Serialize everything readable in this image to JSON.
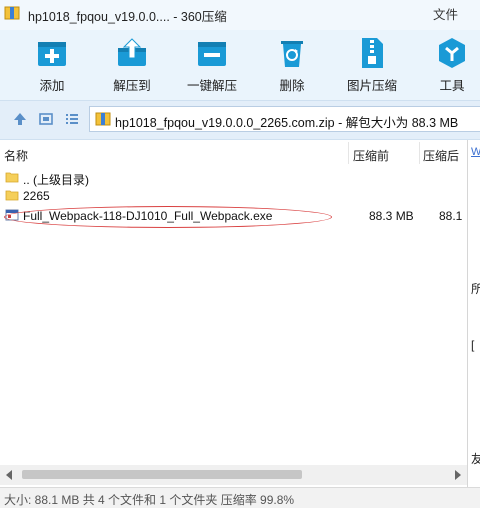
{
  "window": {
    "title": "hp1018_fpqou_v19.0.0.... - 360压缩",
    "menu_file": "文件"
  },
  "toolbar": {
    "items": [
      {
        "label": "添加",
        "icon": "add-icon"
      },
      {
        "label": "解压到",
        "icon": "extract-to-icon"
      },
      {
        "label": "一键解压",
        "icon": "one-click-extract-icon"
      },
      {
        "label": "删除",
        "icon": "recycle-bin-icon"
      },
      {
        "label": "图片压缩",
        "icon": "image-compress-icon"
      },
      {
        "label": "工具",
        "icon": "tools-icon"
      }
    ]
  },
  "address": {
    "path": "hp1018_fpqou_v19.0.0.0_2265.com.zip - 解包大小为 88.3 MB"
  },
  "columns": {
    "name": "名称",
    "compressed": "压缩前",
    "after": "压缩后"
  },
  "rows": [
    {
      "name": ".. (上级目录)",
      "size_before": "",
      "size_after": "",
      "icon": "folder-icon"
    },
    {
      "name": "2265",
      "size_before": "",
      "size_after": "",
      "icon": "folder-icon"
    },
    {
      "name": "Full_Webpack-118-DJ1010_Full_Webpack.exe",
      "size_before": "88.3 MB",
      "size_after": "88.1",
      "icon": "exe-file-icon"
    }
  ],
  "right_pane": {
    "link": "WW",
    "chars": [
      "所",
      "[",
      "友"
    ]
  },
  "status": {
    "text": "大小: 88.1 MB 共 4 个文件和 1 个文件夹 压缩率 99.8%"
  },
  "colors": {
    "accent": "#1a9ad6",
    "toolbar_bg": "#eaf4fc",
    "annotation": "#d94040"
  }
}
